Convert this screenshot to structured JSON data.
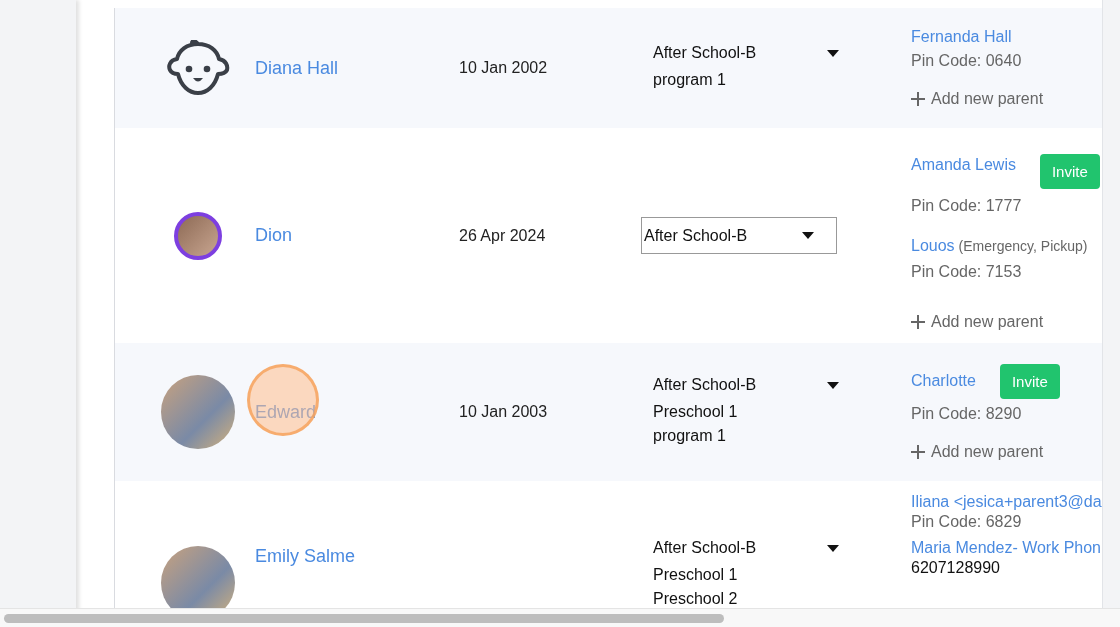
{
  "rows": [
    {
      "avatar": {
        "kind": "baby-icon"
      },
      "name": "Diana Hall",
      "click_marker": false,
      "birth_date": "10 Jan 2002",
      "program": {
        "kind": "list",
        "items": [
          "After School-B",
          "program 1"
        ]
      },
      "parents": [
        {
          "name": "Fernanda Hall",
          "kind": "pin",
          "detail": "Pin Code: 0640"
        }
      ],
      "add_parent": "Add new parent"
    },
    {
      "avatar": {
        "kind": "ringed-photo"
      },
      "name": "Dion",
      "click_marker": false,
      "birth_date": "26 Apr 2024",
      "program": {
        "kind": "select",
        "items": [
          "After School-B"
        ]
      },
      "parents": [
        {
          "name": "Amanda Lewis",
          "invite": "Invite",
          "kind": "pin",
          "detail": "Pin Code: 1777"
        },
        {
          "name": "Louos",
          "note": "(Emergency, Pickup)",
          "kind": "pin",
          "detail": "Pin Code: 7153"
        }
      ],
      "add_parent": "Add new parent"
    },
    {
      "avatar": {
        "kind": "photo"
      },
      "name": "Edward",
      "click_marker": true,
      "birth_date": "10 Jan 2003",
      "program": {
        "kind": "list",
        "items": [
          "After School-B",
          "Preschool 1",
          "program 1"
        ]
      },
      "parents": [
        {
          "name": "Charlotte",
          "invite": "Invite",
          "kind": "pin",
          "detail": "Pin Code: 8290"
        }
      ],
      "add_parent": "Add new parent"
    },
    {
      "avatar": {
        "kind": "photo"
      },
      "name": "Emily Salme",
      "click_marker": false,
      "program": {
        "kind": "list",
        "items": [
          "After School-B",
          "Preschool 1",
          "Preschool 2"
        ]
      },
      "parents": [
        {
          "name": "Iliana <jesica+parent3@da",
          "kind": "pin",
          "detail": "Pin Code: 6829"
        },
        {
          "name": "Maria Mendez- Work Phon",
          "kind": "phone",
          "detail": "6207128990"
        }
      ]
    }
  ]
}
